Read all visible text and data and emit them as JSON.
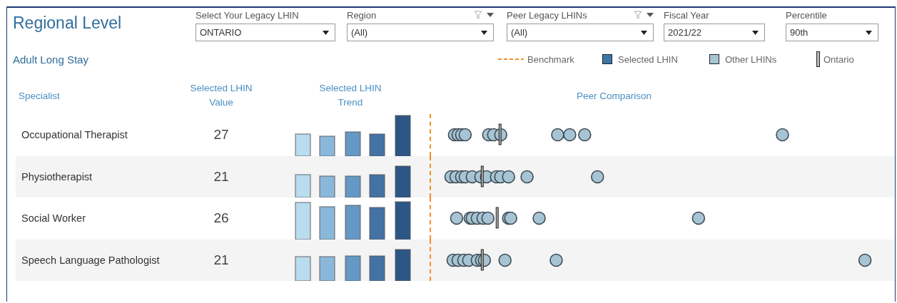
{
  "title": "Regional Level",
  "filters": [
    {
      "label": "Select Your Legacy LHIN",
      "value": "ONTARIO",
      "filter_menu": false
    },
    {
      "label": "Region",
      "value": "(All)",
      "filter_menu": true
    },
    {
      "label": "Peer Legacy LHINs",
      "value": "(All)",
      "filter_menu": true
    },
    {
      "label": "Fiscal Year",
      "value": "2021/22",
      "filter_menu": false
    },
    {
      "label": "Percentile",
      "value": "90th",
      "filter_menu": false
    }
  ],
  "subtitle": "Adult Long Stay",
  "legend": [
    {
      "kind": "benchmark",
      "label": "Benchmark"
    },
    {
      "kind": "selected",
      "label": "Selected LHIN"
    },
    {
      "kind": "other",
      "label": "Other LHINs"
    },
    {
      "kind": "ontario",
      "label": "Ontario"
    }
  ],
  "columns": [
    "Specialist",
    "Selected LHIN Value",
    "Selected LHIN Trend",
    "Peer Comparison"
  ],
  "rows": [
    {
      "name": "Occupational Therapist",
      "value": "27"
    },
    {
      "name": "Physiotherapist",
      "value": "21"
    },
    {
      "name": "Social Worker",
      "value": "26"
    },
    {
      "name": "Speech Language Pathologist",
      "value": "21"
    }
  ]
}
